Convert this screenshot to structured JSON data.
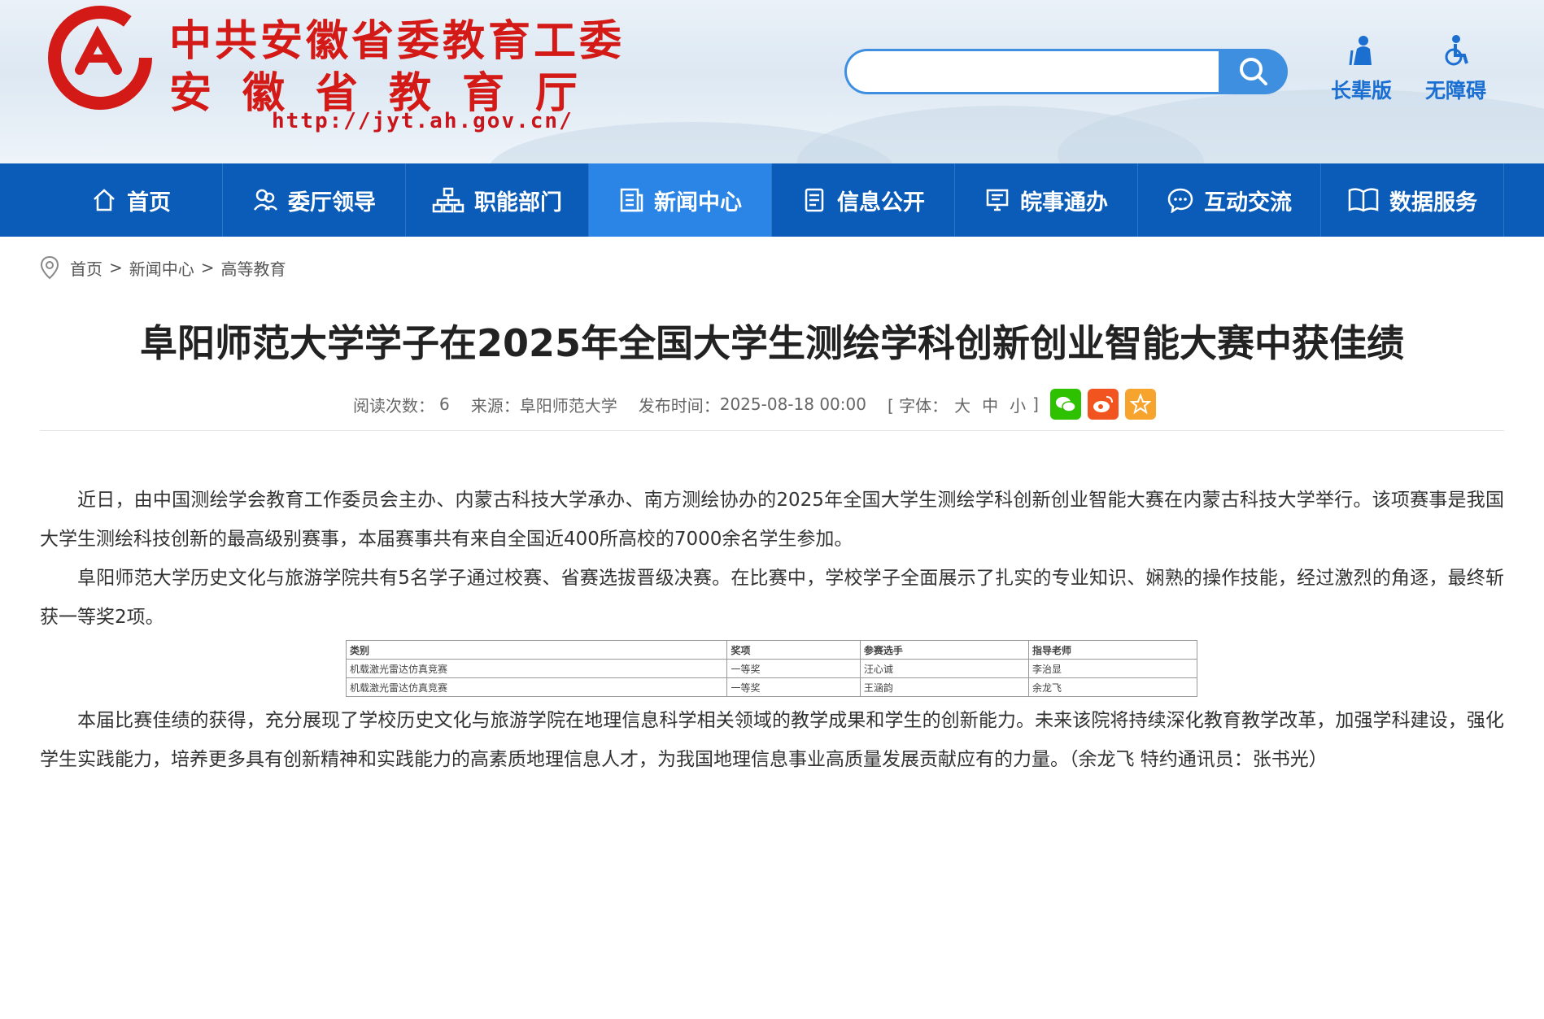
{
  "header": {
    "logo_line1": "中共安徽省委教育工委",
    "logo_line2": "安徽省教育厅",
    "logo_url": "http://jyt.ah.gov.cn/",
    "search_placeholder": "",
    "elder_label": "长辈版",
    "accessible_label": "无障碍"
  },
  "nav": [
    {
      "label": "首页",
      "icon": "home-icon"
    },
    {
      "label": "委厅领导",
      "icon": "people-icon"
    },
    {
      "label": "职能部门",
      "icon": "org-chart-icon"
    },
    {
      "label": "新闻中心",
      "icon": "news-icon"
    },
    {
      "label": "信息公开",
      "icon": "document-icon"
    },
    {
      "label": "皖事通办",
      "icon": "monitor-icon"
    },
    {
      "label": "互动交流",
      "icon": "chat-icon"
    },
    {
      "label": "数据服务",
      "icon": "book-icon"
    }
  ],
  "active_nav": "新闻中心",
  "breadcrumb": [
    "首页",
    "新闻中心",
    "高等教育"
  ],
  "article": {
    "title": "阜阳师范大学学子在2025年全国大学生测绘学科创新创业智能大赛中获佳绩",
    "views_label": "阅读次数：",
    "views": "6",
    "source_label": "来源：",
    "source": "阜阳师范大学",
    "date_label": "发布时间：",
    "date": "2025-08-18 00:00",
    "font_label": "[ 字体：",
    "font_large": "大",
    "font_medium": "中",
    "font_small": "小",
    "font_close": "]",
    "paragraphs": [
      "近日，由中国测绘学会教育工作委员会主办、内蒙古科技大学承办、南方测绘协办的2025年全国大学生测绘学科创新创业智能大赛在内蒙古科技大学举行。该项赛事是我国大学生测绘科技创新的最高级别赛事，本届赛事共有来自全国近400所高校的7000余名学生参加。",
      "阜阳师范大学历史文化与旅游学院共有5名学子通过校赛、省赛选拔晋级决赛。在比赛中，学校学子全面展示了扎实的专业知识、娴熟的操作技能，经过激烈的角逐，最终斩获一等奖2项。",
      "本届比赛佳绩的获得，充分展现了学校历史文化与旅游学院在地理信息科学相关领域的教学成果和学生的创新能力。未来该院将持续深化教育教学改革，加强学科建设，强化学生实践能力，培养更多具有创新精神和实践能力的高素质地理信息人才，为我国地理信息事业高质量发展贡献应有的力量。（余龙飞 特约通讯员：张书光）"
    ],
    "table": {
      "headers": [
        "类别",
        "奖项",
        "参赛选手",
        "指导老师"
      ],
      "rows": [
        [
          "机载激光雷达仿真竞赛",
          "一等奖",
          "汪心诚",
          "李治显"
        ],
        [
          "机载激光雷达仿真竞赛",
          "一等奖",
          "王涵韵",
          "余龙飞"
        ]
      ]
    }
  },
  "colors": {
    "nav": "#0a5cb8",
    "nav_active": "#2a85e6",
    "logo_red": "#d31a17",
    "tool_blue": "#1a6fd1"
  }
}
